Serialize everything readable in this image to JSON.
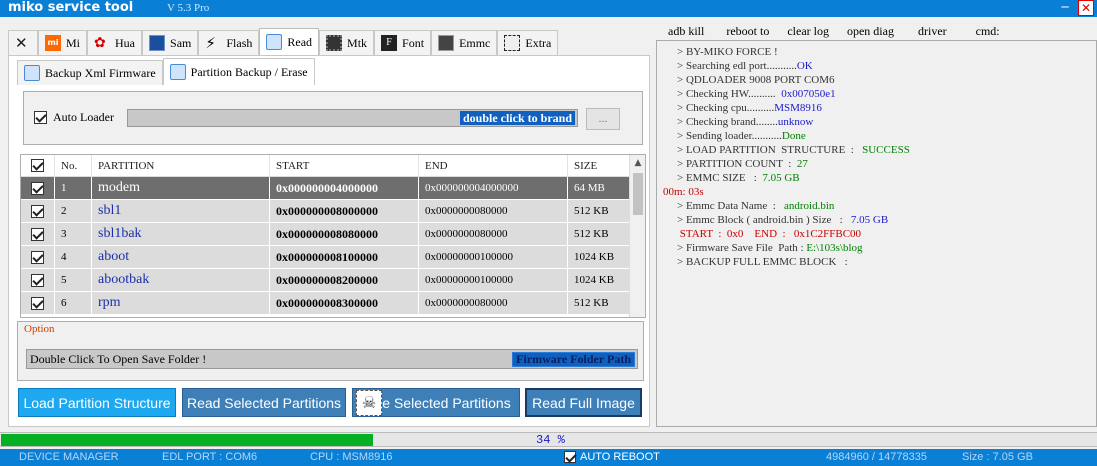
{
  "title": {
    "app": "miko service tool",
    "version": "V 5.3 Pro",
    "min": "─",
    "close": "✕"
  },
  "main_tabs": [
    {
      "label": "",
      "icon": "tools-icon"
    },
    {
      "label": "Mi",
      "icon": "mi-icon"
    },
    {
      "label": "Hua",
      "icon": "huawei-icon"
    },
    {
      "label": "Sam",
      "icon": "samsung-icon"
    },
    {
      "label": "Flash",
      "icon": "flash-icon"
    },
    {
      "label": "Read",
      "icon": "read-icon",
      "active": true
    },
    {
      "label": "Mtk",
      "icon": "chip-icon"
    },
    {
      "label": "Font",
      "icon": "font-icon"
    },
    {
      "label": "Emmc",
      "icon": "emmc-icon"
    },
    {
      "label": "Extra",
      "icon": "extra-icon"
    }
  ],
  "sub_tabs": [
    {
      "label": "Backup Xml Firmware"
    },
    {
      "label": "Partition Backup / Erase",
      "active": true
    }
  ],
  "loader": {
    "auto_loader_label": "Auto Loader",
    "brand_label": "double click to brand",
    "browse_label": "..."
  },
  "grid": {
    "headers": [
      "",
      "No.",
      "PARTITION",
      "START",
      "END",
      "SIZE"
    ],
    "rows": [
      {
        "no": "1",
        "name": "modem",
        "start": "0x000000004000000",
        "end": "0x000000004000000",
        "size": "64 MB",
        "selected": true
      },
      {
        "no": "2",
        "name": "sbl1",
        "start": "0x000000008000000",
        "end": "0x0000000080000",
        "size": "512 KB"
      },
      {
        "no": "3",
        "name": "sbl1bak",
        "start": "0x000000008080000",
        "end": "0x0000000080000",
        "size": "512 KB"
      },
      {
        "no": "4",
        "name": "aboot",
        "start": "0x000000008100000",
        "end": "0x00000000100000",
        "size": "1024 KB"
      },
      {
        "no": "5",
        "name": "abootbak",
        "start": "0x000000008200000",
        "end": "0x00000000100000",
        "size": "1024 KB"
      },
      {
        "no": "6",
        "name": "rpm",
        "start": "0x000000008300000",
        "end": "0x0000000080000",
        "size": "512 KB"
      }
    ]
  },
  "option": {
    "legend": "Option",
    "open_folder": "Double Click To Open Save Folder !",
    "folder_path": "Firmware Folder Path"
  },
  "buttons": {
    "load": "Load Partition Structure",
    "read_selected": "Read Selected Partitions",
    "erase_selected": "se Selected Partitions",
    "read_full": "Read Full Image"
  },
  "right_toolbar": [
    "adb kill",
    "reboot to",
    "clear log",
    "open diag",
    "driver",
    "cmd:"
  ],
  "log": [
    {
      "parts": [
        {
          "t": "> BY-MIKO FORCE !",
          "c": "gy"
        }
      ]
    },
    {
      "parts": [
        {
          "t": "> Searching edl port...........",
          "c": "gy"
        },
        {
          "t": "OK",
          "c": "bl"
        }
      ]
    },
    {
      "parts": [
        {
          "t": "> QDLOADER 9008 PORT COM6",
          "c": "gy"
        }
      ]
    },
    {
      "parts": [
        {
          "t": "> Checking HW..........  ",
          "c": "gy"
        },
        {
          "t": "0x007050e1",
          "c": "bl"
        }
      ]
    },
    {
      "parts": [
        {
          "t": "> Checking cpu..........",
          "c": "gy"
        },
        {
          "t": "MSM8916",
          "c": "bl"
        }
      ]
    },
    {
      "parts": [
        {
          "t": "> Checking brand........",
          "c": "gy"
        },
        {
          "t": "unknow",
          "c": "bl"
        }
      ]
    },
    {
      "parts": [
        {
          "t": "> Sending loader...........",
          "c": "gy"
        },
        {
          "t": "Done",
          "c": "gr"
        }
      ]
    },
    {
      "parts": [
        {
          "t": "> LOAD PARTITION  STRUCTURE  :   ",
          "c": "gy"
        },
        {
          "t": "SUCCESS",
          "c": "gr"
        }
      ]
    },
    {
      "parts": [
        {
          "t": "> PARTITION COUNT  :  ",
          "c": "gy"
        },
        {
          "t": "27",
          "c": "gr"
        }
      ]
    },
    {
      "parts": [
        {
          "t": "> EMMC SIZE   :  ",
          "c": "gy"
        },
        {
          "t": "7.05 GB",
          "c": "gr"
        }
      ]
    },
    {
      "parts": [
        {
          "t": "00m: 03s",
          "c": "rd"
        }
      ],
      "indent": -14
    },
    {
      "parts": [
        {
          "t": "> Emmc Data Name  :   ",
          "c": "gy"
        },
        {
          "t": "android.bin",
          "c": "gr"
        }
      ]
    },
    {
      "parts": [
        {
          "t": "> Emmc Block ( android.bin ) Size   :   ",
          "c": "gy"
        },
        {
          "t": "7.05 GB",
          "c": "bl"
        }
      ]
    },
    {
      "parts": [
        {
          "t": " START  :  0x0    END  :   0x1C2FFBC00",
          "c": "rd"
        }
      ]
    },
    {
      "parts": [
        {
          "t": "> Firmware Save File  Path : ",
          "c": "gy"
        },
        {
          "t": "E:\\103s\\blog",
          "c": "gr"
        }
      ]
    },
    {
      "parts": [
        {
          "t": "> BACKUP FULL EMMC BLOCK   :",
          "c": "gy"
        }
      ]
    }
  ],
  "progress": {
    "percent": 34,
    "label": "34 %"
  },
  "status": {
    "device_manager": "DEVICE MANAGER",
    "edl_port": "EDL PORT  :     COM6",
    "cpu": "CPU  :     MSM8916",
    "auto_reboot": "AUTO REBOOT",
    "counter": "4984960   /   14778335",
    "size": "Size  :  7.05 GB"
  },
  "colors": {
    "titlebar": "#0a7fd6",
    "accent_button": "#1ea8f0",
    "button": "#3f7fb8",
    "progress": "#06b025"
  }
}
